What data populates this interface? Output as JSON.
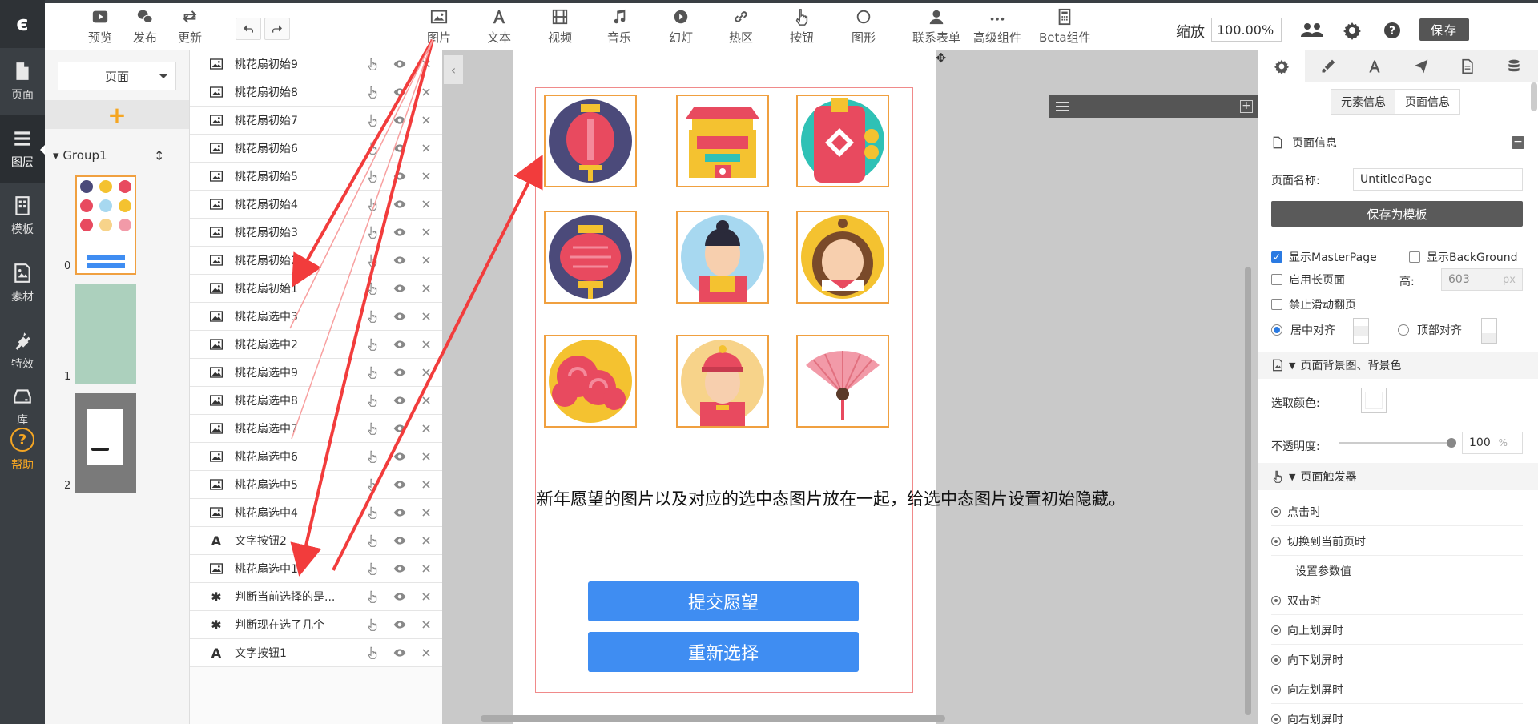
{
  "leftnav": {
    "logo": "є",
    "items": [
      {
        "label": "页面",
        "icon": "page-icon"
      },
      {
        "label": "图层",
        "icon": "layers-icon"
      },
      {
        "label": "模板",
        "icon": "template-icon"
      },
      {
        "label": "素材",
        "icon": "image-icon"
      },
      {
        "label": "特效",
        "icon": "plug-icon"
      },
      {
        "label": "库",
        "icon": "drive-icon"
      }
    ],
    "help_label": "帮助",
    "help_glyph": "?"
  },
  "toolbar": {
    "left": [
      {
        "label": "预览",
        "icon": "play-icon"
      },
      {
        "label": "发布",
        "icon": "wechat-icon"
      },
      {
        "label": "更新",
        "icon": "refresh-icon"
      }
    ],
    "components": [
      {
        "label": "图片",
        "icon": "image-icon"
      },
      {
        "label": "文本",
        "icon": "text-icon"
      },
      {
        "label": "视频",
        "icon": "film-icon"
      },
      {
        "label": "音乐",
        "icon": "music-icon"
      },
      {
        "label": "幻灯",
        "icon": "slideshow-icon"
      },
      {
        "label": "热区",
        "icon": "link-icon"
      },
      {
        "label": "按钮",
        "icon": "pointer-icon"
      },
      {
        "label": "图形",
        "icon": "circle-icon"
      },
      {
        "label": "联系表单",
        "icon": "user-icon"
      },
      {
        "label": "高级组件",
        "icon": "ellipsis-icon"
      },
      {
        "label": "Beta组件",
        "icon": "calculator-icon"
      }
    ],
    "zoom_label": "缩放",
    "zoom_value": "100.00%",
    "save_label": "保存",
    "more_glyph": "⋮"
  },
  "pages": {
    "select_label": "页面",
    "add_glyph": "+",
    "group_label": "Group1",
    "group_toggle": "▾",
    "sort_glyph": "↕",
    "thumbs": [
      "0",
      "1",
      "2"
    ]
  },
  "layers": [
    {
      "name": "桃花扇初始9",
      "type": "image"
    },
    {
      "name": "桃花扇初始8",
      "type": "image"
    },
    {
      "name": "桃花扇初始7",
      "type": "image"
    },
    {
      "name": "桃花扇初始6",
      "type": "image"
    },
    {
      "name": "桃花扇初始5",
      "type": "image"
    },
    {
      "name": "桃花扇初始4",
      "type": "image"
    },
    {
      "name": "桃花扇初始3",
      "type": "image"
    },
    {
      "name": "桃花扇初始2",
      "type": "image"
    },
    {
      "name": "桃花扇初始1",
      "type": "image"
    },
    {
      "name": "桃花扇选中3",
      "type": "image"
    },
    {
      "name": "桃花扇选中2",
      "type": "image"
    },
    {
      "name": "桃花扇选中9",
      "type": "image"
    },
    {
      "name": "桃花扇选中8",
      "type": "image"
    },
    {
      "name": "桃花扇选中7",
      "type": "image"
    },
    {
      "name": "桃花扇选中6",
      "type": "image"
    },
    {
      "name": "桃花扇选中5",
      "type": "image"
    },
    {
      "name": "桃花扇选中4",
      "type": "image"
    },
    {
      "name": "文字按钮2",
      "type": "text"
    },
    {
      "name": "桃花扇选中1",
      "type": "image"
    },
    {
      "name": "判断当前选择的是...",
      "type": "script"
    },
    {
      "name": "判断现在选了几个",
      "type": "script"
    },
    {
      "name": "文字按钮1",
      "type": "text"
    }
  ],
  "layer_type_glyphs": {
    "text": "A",
    "script": "✱"
  },
  "canvas": {
    "collapse_glyph": "‹",
    "move_glyph": "✥",
    "float_plus": "+",
    "description": "新年愿望的图片以及对应的选中态图片放在一起，给选中态图片设置初始隐藏。",
    "submit_label": "提交愿望",
    "reset_label": "重新选择",
    "tiles": [
      "lantern-purple-icon",
      "palace-icon",
      "red-envelope-icon",
      "lantern-red-icon",
      "boy-icon",
      "monkey-icon",
      "cloud-icon",
      "child-icon",
      "fan-icon"
    ]
  },
  "props": {
    "tabs": [
      "gear-icon",
      "brush-icon",
      "font-icon",
      "send-icon",
      "document-icon",
      "database-icon"
    ],
    "seg_element": "元素信息",
    "seg_page": "页面信息",
    "page_info_title": "页面信息",
    "page_info_toggle": "−",
    "page_name_label": "页面名称:",
    "page_name_value": "UntitledPage",
    "save_template_label": "保存为模板",
    "show_master": "显示MasterPage",
    "show_background": "显示BackGround",
    "long_page": "启用长页面",
    "height_label": "高:",
    "height_value": "603",
    "height_unit": "px",
    "no_swipe": "禁止滑动翻页",
    "center_align": "居中对齐",
    "top_align": "顶部对齐",
    "bg_section": "页面背景图、背景色",
    "pick_color_label": "选取颜色:",
    "opacity_label": "不透明度:",
    "opacity_value": "100",
    "opacity_unit": "%",
    "trigger_section": "页面触发器",
    "triggers": [
      "点击时",
      "切换到当前页时",
      "设置参数值",
      "双击时",
      "向上划屏时",
      "向下划屏时",
      "向左划屏时",
      "向右划屏时"
    ],
    "check_mark": "✓"
  },
  "colors": {
    "accent_blue": "#3f8df2",
    "arrow_red": "#f23c3c",
    "tile_border": "#f0a040",
    "nav_dark": "#3a3f44",
    "help_orange": "#f5a623"
  }
}
